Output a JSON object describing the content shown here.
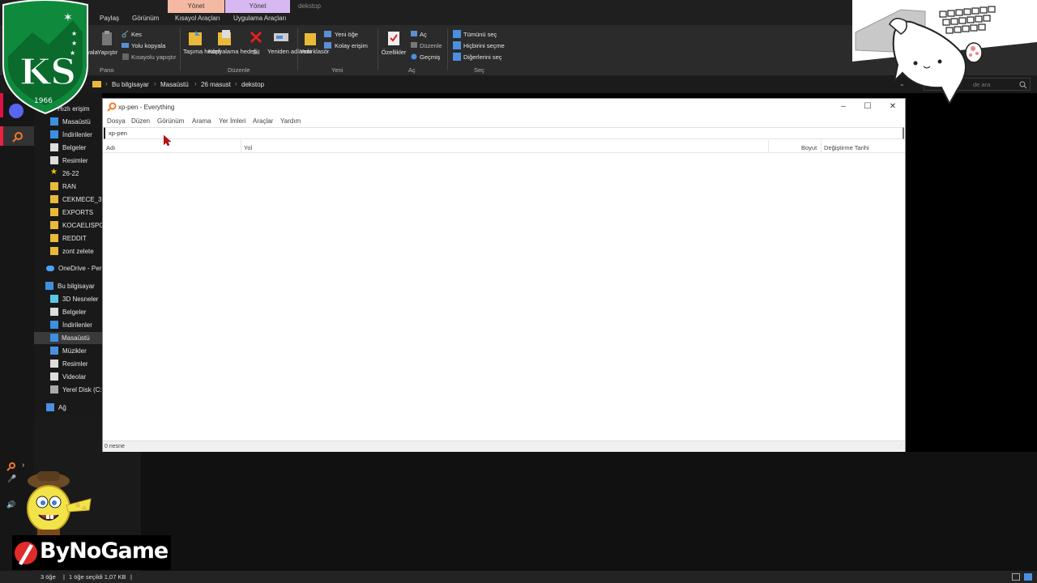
{
  "explorer": {
    "ribbon_context_tabs": [
      "Yönet",
      "Yönet",
      "dekstop"
    ],
    "ribbon_tabs": [
      "Paylaş",
      "Görünüm",
      "Kısayol Araçları",
      "Uygulama Araçları"
    ],
    "clipboard": {
      "cut": "Kes",
      "copy_path": "Yolu kopyala",
      "paste_shortcut": "Kısayolu yapıştır",
      "copy": "yala",
      "paste": "Yapıştır",
      "group": "Pano"
    },
    "organize": {
      "move_to": "Taşıma hedefi",
      "copy_to": "Kopyalama hedefi",
      "delete": "Sil",
      "rename": "Yeniden adlandır",
      "group": "Düzenle"
    },
    "new": {
      "new_folder": "Yeni klasör",
      "new_item": "Yeni öğe",
      "easy_access": "Kolay erişim",
      "group": "Yeni"
    },
    "open": {
      "properties": "Özellikler",
      "open": "Aç",
      "edit": "Düzenle",
      "history": "Geçmiş",
      "group": "Aç"
    },
    "select": {
      "select_all": "Tümünü seç",
      "select_none": "Hiçbirini seçme",
      "invert": "Diğerlerini seç",
      "group": "Seç"
    },
    "breadcrumb": [
      "Bu bilgisayar",
      "Masaüstü",
      "26 masust",
      "dekstop"
    ],
    "search_placeholder": "de ara",
    "nav": {
      "quick_access": "Hızlı erişim",
      "items": [
        {
          "label": "Masaüstü",
          "icon": "desktop-icon"
        },
        {
          "label": "İndirilenler",
          "icon": "download-icon"
        },
        {
          "label": "Belgeler",
          "icon": "document-icon"
        },
        {
          "label": "Resimler",
          "icon": "picture-icon"
        },
        {
          "label": "26-22",
          "icon": "star-icon"
        },
        {
          "label": "RAN",
          "icon": "folder-icon"
        },
        {
          "label": "CEKMECE_3",
          "icon": "folder-icon"
        },
        {
          "label": "EXPORTS",
          "icon": "folder-icon"
        },
        {
          "label": "KOCAELISPOR",
          "icon": "folder-icon"
        },
        {
          "label": "REDDIT",
          "icon": "folder-icon"
        },
        {
          "label": "zont zelete",
          "icon": "folder-icon"
        }
      ],
      "onedrive": "OneDrive - Pers",
      "this_pc": "Bu bilgisayar",
      "pc_items": [
        {
          "label": "3D Nesneler",
          "icon": "cube-icon"
        },
        {
          "label": "Belgeler",
          "icon": "document-icon"
        },
        {
          "label": "İndirilenler",
          "icon": "download-icon"
        },
        {
          "label": "Masaüstü",
          "icon": "desktop-icon"
        },
        {
          "label": "Müzikler",
          "icon": "music-icon"
        },
        {
          "label": "Resimler",
          "icon": "picture-icon"
        },
        {
          "label": "Videolar",
          "icon": "video-icon"
        },
        {
          "label": "Yerel Disk (C:)",
          "icon": "disk-icon"
        }
      ],
      "network": "Ağ"
    },
    "status": {
      "count": "3 öğe",
      "selected": "1 öğe seçildi  1,07 KB"
    }
  },
  "everything": {
    "title": "xp-pen - Everything",
    "menu": [
      "Dosya",
      "Düzen",
      "Görünüm",
      "Arama",
      "Yer İmleri",
      "Araçlar",
      "Yardım"
    ],
    "search_value": "xp-pen",
    "columns": [
      "Adı",
      "Yol",
      "Boyut",
      "Değiştirme Tarihi"
    ],
    "status": "0 nesne"
  },
  "overlay": {
    "logo_text": "1966",
    "logo_letters": "KS",
    "banner_text": "ByNoGame"
  },
  "colors": {
    "ribbon_bg": "#2b2b2b",
    "ctx_tab_orange": "#f4b9a3",
    "ctx_tab_purple": "#d8b8f0",
    "logo_green": "#0f8a3c"
  }
}
